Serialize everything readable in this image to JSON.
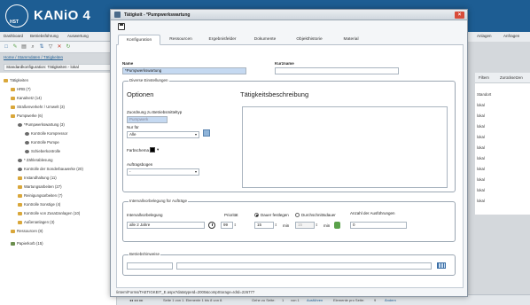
{
  "app": {
    "title": "KANiO 4",
    "logo_text": "HST",
    "menu": [
      "Dashboard",
      "Betriebsführung",
      "Auswertung"
    ],
    "breadcrumb": "Home / Stammdaten / Tätigkeiten",
    "conf_label": "Standardkonfiguration: Tätigkeiten - lokal",
    "right_menu": [
      "Anlagen",
      "Anfragen"
    ],
    "right_table": {
      "headers": [
        "Filtern",
        "Zurücksetzen"
      ],
      "column": "Standort",
      "rows": [
        "lokal",
        "lokal",
        "lokal",
        "lokal",
        "lokal",
        "lokal",
        "lokal",
        "lokal",
        "lokal",
        "lokal"
      ]
    }
  },
  "tree": [
    "Tätigkeiten",
    "HRB (7)",
    "Kanalnetz (14)",
    "Straßenverkehr / Umwelt (3)",
    "Pumpwerke (6)",
    "*Pumpwerkswartung (3)",
    "Kontrolle Kompressor",
    "Kontrolle Pumpe",
    "Schieberkontrolle",
    "* Zählerablesung",
    "Kontrolle der Sonderbauwerke (20)",
    "Instandhaltung (11)",
    "Wartungsarbeiten (27)",
    "Reinigungsarbeiten (7)",
    "Kontrolle Sonstige (4)",
    "Kontrolle von Zusatzanlagen (10)",
    "Außenanlagen (3)",
    "Ressourcen (8)",
    "Papierkorb (15)"
  ],
  "pager": {
    "text": "Seite 1 von 1. Elemente 1 bis 8 von 8.",
    "goto_label": "Gehe zu Seite:",
    "page_value": "1",
    "page_of": "von 1",
    "execute": "Ausführen",
    "per_page_label": "Elemente pro Seite:",
    "per_page_value": "9",
    "apply": "Ändern"
  },
  "dialog": {
    "title": "Tätigkeit - *Pumpwerkswartung",
    "tabs": [
      "Konfiguration",
      "Ressourcen",
      "Ergebnisfelder",
      "Dokumente",
      "Objekthistorie",
      "Material"
    ],
    "active_tab": "Konfiguration",
    "name_label": "Name",
    "name_value": "*Pumpwerkswartung",
    "short_label": "Kurzname",
    "short_value": "",
    "diverse_legend": "Diverse Einstellungen",
    "options_title": "Optionen",
    "description_title": "Tätigkeitsbeschreibung",
    "assignment_label": "Zuordnung zu Betriebsmitteltyp",
    "assignment_value": "Pumpwerk",
    "only_for_label": "Nur für",
    "only_for_value": "Alle",
    "color_label": "Farbschema",
    "order_sheet_label": "Auftragsbogen",
    "order_sheet_value": "-",
    "interval_legend": "Intervallvorbelegung für Aufträge",
    "interval_label": "Intervallvorbelegung",
    "interval_value": "alle 2 Jahre",
    "priority_label": "Priorität",
    "priority_value": "99",
    "radio_fixed": "Dauer festlegen",
    "radio_avg": "Durchschnittsdauer",
    "duration_value": "15",
    "min_label": "min",
    "avg_value": "15",
    "min_label2": "min",
    "count_label": "Anzahl der Ausführungen",
    "count_value": "0",
    "notes_legend": "Betriebshinweise",
    "status_url": "/intern/Forms/TAETIGKEIT_E.aspx?datatypeId=2000&compStorage=IdId=226777"
  },
  "colors": {
    "header_blue": "#1d5d93",
    "close_red": "#d84c3a",
    "highlight": "#c5d9f1"
  }
}
